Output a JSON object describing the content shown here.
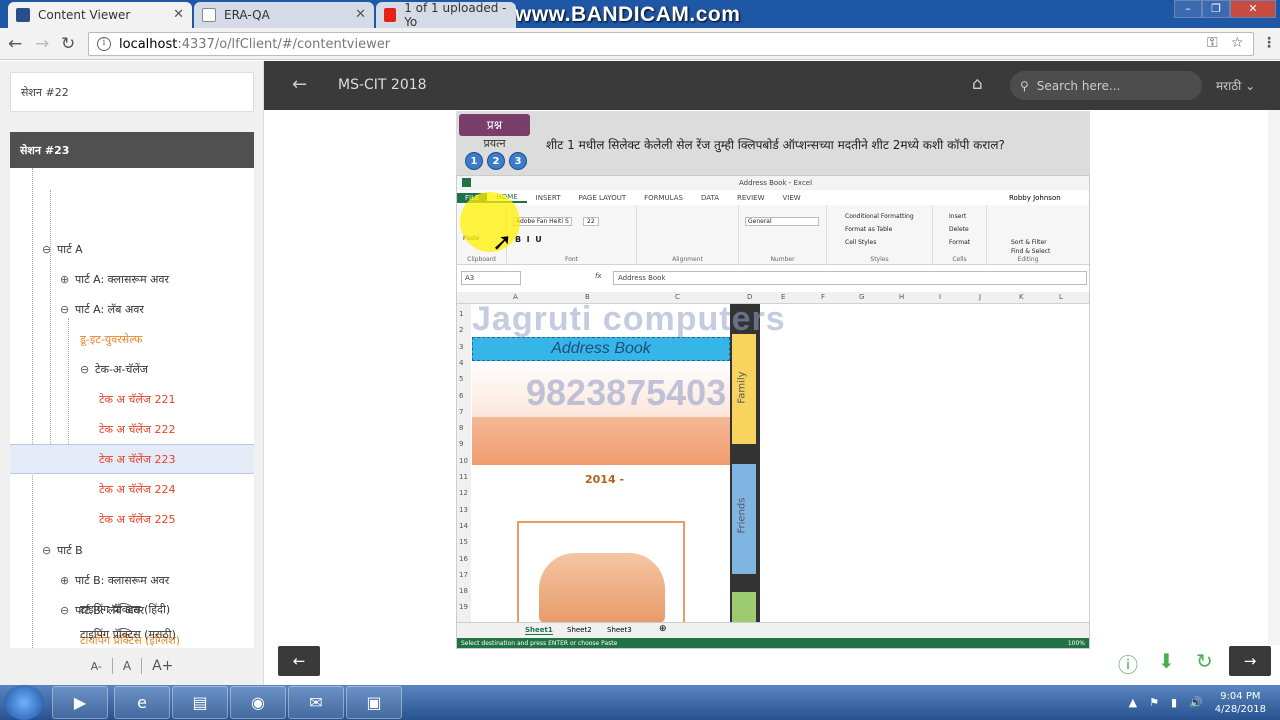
{
  "browser": {
    "tabs": [
      {
        "title": "Content Viewer"
      },
      {
        "title": "ERA-QA"
      },
      {
        "title": "1 of 1 uploaded - Yo"
      }
    ],
    "watermark": "www.BANDICAM.com",
    "url_domain": "localhost",
    "url_path": ":4337/o/lfClient/#/contentviewer"
  },
  "sidebar": {
    "prev_session": "सेशन #22",
    "current_session": "सेशन #23",
    "tree": [
      {
        "label": "पार्ट A",
        "exp": "⊖"
      },
      {
        "label": "पार्ट A: क्लासरूम अवर",
        "exp": "⊕"
      },
      {
        "label": "पार्ट A: लॅब अवर",
        "exp": "⊖"
      },
      {
        "label": "डू-इट-युवरसेल्फ",
        "exp": ""
      },
      {
        "label": "टेक-अ-चॅलेंज",
        "exp": "⊖"
      },
      {
        "label": "टेक अ चॅलेंज 221",
        "exp": ""
      },
      {
        "label": "टेक अ चॅलेंज 222",
        "exp": ""
      },
      {
        "label": "टेक अ चॅलेंज 223",
        "exp": ""
      },
      {
        "label": "टेक अ चॅलेंज 224",
        "exp": ""
      },
      {
        "label": "टेक अ चॅलेंज 225",
        "exp": ""
      },
      {
        "label": "पार्ट B",
        "exp": "⊖"
      },
      {
        "label": "पार्ट B: क्लासरूम अवर",
        "exp": "⊕"
      },
      {
        "label": "पार्ट B: लॅब अवर",
        "exp": "⊖"
      },
      {
        "label": "टायपिंग प्रॅक्टिस (इंग्लिश)",
        "exp": ""
      },
      {
        "label": "टाइपिंग प्रॅक्टिस (हिंदी)",
        "exp": ""
      },
      {
        "label": "टाइपिंग प्रॅक्टिस (मराठी)",
        "exp": ""
      }
    ],
    "font_controls": [
      "A-",
      "A",
      "A+"
    ]
  },
  "appbar": {
    "title": "MS-CIT 2018",
    "search_placeholder": "Search here...",
    "language": "मराठी"
  },
  "question": {
    "tag": "प्रश्न",
    "sub": "प्रयत्न",
    "nums": [
      "1",
      "2",
      "3"
    ],
    "text": "शीट 1 मधील सिलेक्ट केलेली सेल रेंज तुम्ही क्लिपबोर्ड ऑप्शन्सच्या मदतीने शीट 2मध्ये कशी कॉपी कराल?"
  },
  "excel": {
    "window_title": "Address Book - Excel",
    "user": "Robby Johnson",
    "tabs": [
      "FILE",
      "HOME",
      "INSERT",
      "PAGE LAYOUT",
      "FORMULAS",
      "DATA",
      "REVIEW",
      "VIEW"
    ],
    "font_name": "Adobe Fan Heiti S",
    "font_size": "22",
    "number_format": "General",
    "groups": [
      "Clipboard",
      "Font",
      "Alignment",
      "Number",
      "Styles",
      "Cells",
      "Editing"
    ],
    "styles_items": [
      "Conditional Formatting",
      "Format as Table",
      "Cell Styles"
    ],
    "cells_items": [
      "Insert",
      "Delete",
      "Format"
    ],
    "editing_items": [
      "Sort & Filter",
      "Find & Select"
    ],
    "paste_label": "Paste",
    "name_box": "A3",
    "formula": "Address Book",
    "columns": [
      "A",
      "B",
      "C",
      "D",
      "E",
      "F",
      "G",
      "H",
      "I",
      "J",
      "K",
      "L"
    ],
    "rows": [
      "1",
      "2",
      "3",
      "4",
      "5",
      "6",
      "7",
      "8",
      "9",
      "10",
      "11",
      "12",
      "13",
      "14",
      "15",
      "16",
      "17",
      "18",
      "19"
    ],
    "banner": "Address Book",
    "year": "2014 -",
    "family_tab": "Family",
    "friends_tab": "Friends",
    "watermark_name": "Jagruti computers",
    "watermark_phone": "9823875403",
    "sheets": [
      "Sheet1",
      "Sheet2",
      "Sheet3"
    ],
    "status": "Select destination and press ENTER or choose Paste",
    "zoom": "100%"
  },
  "taskbar": {
    "time": "9:04 PM",
    "date": "4/28/2018"
  }
}
